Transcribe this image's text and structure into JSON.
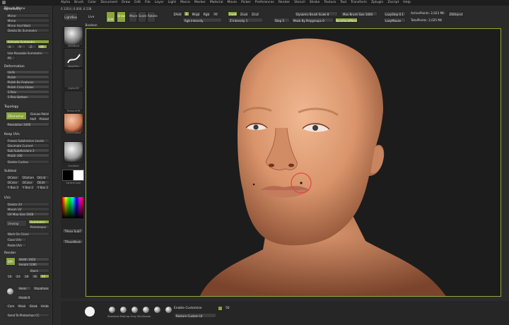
{
  "menu": {
    "items": [
      "Alpha",
      "Brush",
      "Color",
      "Document",
      "Draw",
      "Edit",
      "File",
      "Layer",
      "Light",
      "Macro",
      "Marker",
      "Material",
      "Movie",
      "Picker",
      "Preferences",
      "Render",
      "Stencil",
      "Stroke",
      "Texture",
      "Tool",
      "Transform",
      "Zplugin",
      "Zscript",
      "Help"
    ]
  },
  "left_panel": {
    "title": "ZBrush Menu",
    "counter": "0.1354 | 0.000, 6.538",
    "symmetry": {
      "header": "Symmetry",
      "items": [
        "Mirror",
        "Mirror",
        "Mirror And Weld",
        "Delete By Symmetry"
      ],
      "activate": "Activate Symmetry",
      "axes": [
        "-X-",
        "-Y-",
        "-Z-",
        "(M)"
      ],
      "use_poseable": "Use Poseable Symmetry",
      "ps": "PS"
    },
    "deformation": {
      "header": "Deformation",
      "items": [
        "Unify",
        "Polish",
        "Polish By Features",
        "Polish Crisp Edges",
        "3 Poly",
        "3 Poly Bottom"
      ]
    },
    "topology": {
      "header": "Topology",
      "zremesher": "ZRemesher",
      "groups": "Groups Polish",
      "project": "Project",
      "half": "Half",
      "resolution": "Resolution 1000"
    },
    "keep": {
      "header": "Keep UVs",
      "items": [
        "Freeze Subdivision Levels",
        "Decimate Current",
        "Sub Subdivisions 2",
        "Polish 100",
        "Delete Caches"
      ]
    },
    "subtool": {
      "header": "Subtool",
      "grid": [
        "DColor",
        "DSphere",
        "DGrid",
        "DColor",
        "DColor",
        "DEdit",
        "Y Box 2",
        "Y Box 2",
        "Y Box 2"
      ]
    },
    "uv": {
      "header": "UVs",
      "items": [
        "Delete UV",
        "Morph UV",
        "UV Map Size 2048",
        "Unwrap",
        "Symmetry",
        "Polygroups",
        "Work On Clone",
        "Copy UVs",
        "Paste UVs"
      ]
    },
    "render": {
      "header": "Render",
      "items": [
        "BPR",
        "Width 1920",
        "Height 1080"
      ],
      "numbers": [
        "18",
        "24",
        "28",
        "36",
        "50"
      ],
      "accent": "Black",
      "more": [
        "Hemi",
        "Roughness",
        "Angle 0",
        "Cam",
        "Mask",
        "Shade",
        "Ambient"
      ],
      "send": "Send To Photoshop CC"
    }
  },
  "top_shelf": {
    "lightbox": "LightBox",
    "live_boolean": "Live Boolean",
    "edit": "Edit",
    "draw": "Draw",
    "move": "Move",
    "scale": "Scale",
    "rotate": "Rotate",
    "zadd_label": "ZAdd",
    "mrgb": "Mrgb",
    "rgb": "Rgb",
    "m": "M",
    "rgb_intensity": "Rgb Intensity",
    "zadd": "Zadd",
    "zsub": "Zsub",
    "zcut": "Zcut",
    "z_intensity": "Z Intensity 1",
    "focal_shift": "Focal Shift 0",
    "draw_size": "Draw Size 64",
    "dynamic": "Dynamic",
    "active_points": "ActivePoints: 2,023 Mil",
    "total_points": "TotalPoints: 2,025 Mil",
    "dynamic_brush": "Dynamic Brush Scale 8",
    "max_brush": "Max Brush Size 1000",
    "lazy_step": "LazyStep 0.1",
    "lazy_mouse": "LazyMouse",
    "mesh_type": "Step",
    "mask_by_poly": "Mask By Polygroups 0",
    "backface": "BackfaceMask",
    "rec": "ZBObject",
    "stepsize": "Step 5"
  },
  "tool_column": {
    "brushes": [
      "Standard",
      "MaskPen",
      "AlphaOff",
      "TextureOff",
      "SkinShade4",
      "MatCap",
      "SphereLight"
    ],
    "color_label": "Gradient",
    "switch": "SwitchColor",
    "tpose": "TPose SubT",
    "tpose_mesh": "TPoseMesh"
  },
  "bottom_bar": {
    "enable_customize": "Enable Customize",
    "restore_custom": "Restore Custom UI",
    "value": "50",
    "brushes": [
      "Standard",
      "MatCap Gray",
      "SkinShade",
      "BasicMaterial",
      "Toy Plastic",
      "Flat Color"
    ]
  },
  "colors": {
    "accent_green": "#8aa53c",
    "viewport_border": "#94a63c",
    "skin": "#e3a57e"
  }
}
